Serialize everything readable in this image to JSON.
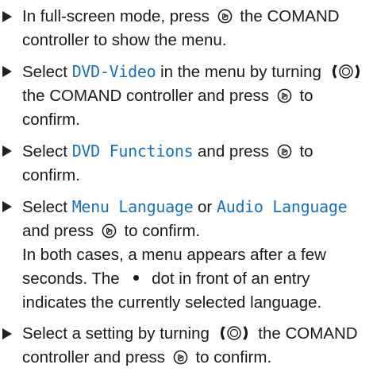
{
  "steps": [
    {
      "p1": "In full-screen mode, press",
      "p2": "the COMAND controller to show the menu."
    },
    {
      "p1": "Select",
      "h1": "DVD-Video",
      "p2": "in the menu by turning",
      "p3": "the COMAND controller and press",
      "p4": "to confirm."
    },
    {
      "p1": "Select",
      "h1": "DVD Functions",
      "p2": "and press",
      "p3": "to confirm."
    },
    {
      "p1": "Select",
      "h1": "Menu Language",
      "p2": "or",
      "h2": "Audio Language",
      "p3": "and press",
      "p4": "to confirm.",
      "p5": "In both cases, a menu appears after a few seconds. The",
      "p6": "dot in front of an entry indicates the currently selected language."
    },
    {
      "p1": "Select a setting by turning",
      "p2": "the COMAND controller and press",
      "p3": "to confirm."
    }
  ],
  "icons": {
    "press": "press-controller-icon",
    "turn": "turn-controller-icon",
    "bullet": "triangle-bullet-icon",
    "dot": "filled-dot-icon"
  },
  "colors": {
    "highlight": "#1a6fb5",
    "text": "#1a1a1a"
  }
}
